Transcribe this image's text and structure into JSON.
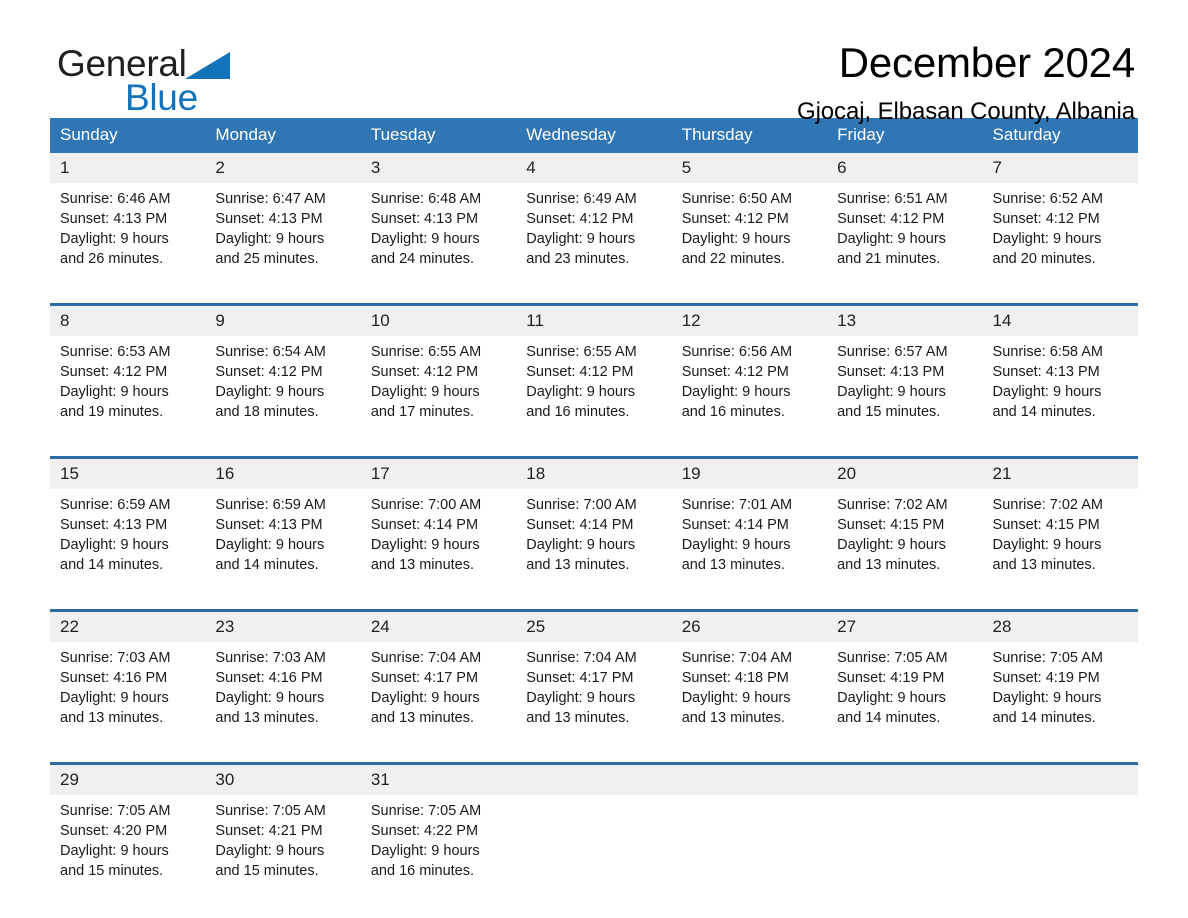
{
  "logo": {
    "word1": "General",
    "word2": "Blue",
    "triangle_color": "#1273ba"
  },
  "header": {
    "title": "December 2024",
    "subtitle": "Gjocaj, Elbasan County, Albania"
  },
  "theme": {
    "header_blue": "#3076b5",
    "separator_blue": "#2e6da4",
    "daynum_bg": "#f0f0f0"
  },
  "calendar": {
    "weekday_headers": [
      "Sunday",
      "Monday",
      "Tuesday",
      "Wednesday",
      "Thursday",
      "Friday",
      "Saturday"
    ],
    "weeks": [
      [
        {
          "day": "1",
          "sunrise": "Sunrise: 6:46 AM",
          "sunset": "Sunset: 4:13 PM",
          "daylight1": "Daylight: 9 hours",
          "daylight2": "and 26 minutes."
        },
        {
          "day": "2",
          "sunrise": "Sunrise: 6:47 AM",
          "sunset": "Sunset: 4:13 PM",
          "daylight1": "Daylight: 9 hours",
          "daylight2": "and 25 minutes."
        },
        {
          "day": "3",
          "sunrise": "Sunrise: 6:48 AM",
          "sunset": "Sunset: 4:13 PM",
          "daylight1": "Daylight: 9 hours",
          "daylight2": "and 24 minutes."
        },
        {
          "day": "4",
          "sunrise": "Sunrise: 6:49 AM",
          "sunset": "Sunset: 4:12 PM",
          "daylight1": "Daylight: 9 hours",
          "daylight2": "and 23 minutes."
        },
        {
          "day": "5",
          "sunrise": "Sunrise: 6:50 AM",
          "sunset": "Sunset: 4:12 PM",
          "daylight1": "Daylight: 9 hours",
          "daylight2": "and 22 minutes."
        },
        {
          "day": "6",
          "sunrise": "Sunrise: 6:51 AM",
          "sunset": "Sunset: 4:12 PM",
          "daylight1": "Daylight: 9 hours",
          "daylight2": "and 21 minutes."
        },
        {
          "day": "7",
          "sunrise": "Sunrise: 6:52 AM",
          "sunset": "Sunset: 4:12 PM",
          "daylight1": "Daylight: 9 hours",
          "daylight2": "and 20 minutes."
        }
      ],
      [
        {
          "day": "8",
          "sunrise": "Sunrise: 6:53 AM",
          "sunset": "Sunset: 4:12 PM",
          "daylight1": "Daylight: 9 hours",
          "daylight2": "and 19 minutes."
        },
        {
          "day": "9",
          "sunrise": "Sunrise: 6:54 AM",
          "sunset": "Sunset: 4:12 PM",
          "daylight1": "Daylight: 9 hours",
          "daylight2": "and 18 minutes."
        },
        {
          "day": "10",
          "sunrise": "Sunrise: 6:55 AM",
          "sunset": "Sunset: 4:12 PM",
          "daylight1": "Daylight: 9 hours",
          "daylight2": "and 17 minutes."
        },
        {
          "day": "11",
          "sunrise": "Sunrise: 6:55 AM",
          "sunset": "Sunset: 4:12 PM",
          "daylight1": "Daylight: 9 hours",
          "daylight2": "and 16 minutes."
        },
        {
          "day": "12",
          "sunrise": "Sunrise: 6:56 AM",
          "sunset": "Sunset: 4:12 PM",
          "daylight1": "Daylight: 9 hours",
          "daylight2": "and 16 minutes."
        },
        {
          "day": "13",
          "sunrise": "Sunrise: 6:57 AM",
          "sunset": "Sunset: 4:13 PM",
          "daylight1": "Daylight: 9 hours",
          "daylight2": "and 15 minutes."
        },
        {
          "day": "14",
          "sunrise": "Sunrise: 6:58 AM",
          "sunset": "Sunset: 4:13 PM",
          "daylight1": "Daylight: 9 hours",
          "daylight2": "and 14 minutes."
        }
      ],
      [
        {
          "day": "15",
          "sunrise": "Sunrise: 6:59 AM",
          "sunset": "Sunset: 4:13 PM",
          "daylight1": "Daylight: 9 hours",
          "daylight2": "and 14 minutes."
        },
        {
          "day": "16",
          "sunrise": "Sunrise: 6:59 AM",
          "sunset": "Sunset: 4:13 PM",
          "daylight1": "Daylight: 9 hours",
          "daylight2": "and 14 minutes."
        },
        {
          "day": "17",
          "sunrise": "Sunrise: 7:00 AM",
          "sunset": "Sunset: 4:14 PM",
          "daylight1": "Daylight: 9 hours",
          "daylight2": "and 13 minutes."
        },
        {
          "day": "18",
          "sunrise": "Sunrise: 7:00 AM",
          "sunset": "Sunset: 4:14 PM",
          "daylight1": "Daylight: 9 hours",
          "daylight2": "and 13 minutes."
        },
        {
          "day": "19",
          "sunrise": "Sunrise: 7:01 AM",
          "sunset": "Sunset: 4:14 PM",
          "daylight1": "Daylight: 9 hours",
          "daylight2": "and 13 minutes."
        },
        {
          "day": "20",
          "sunrise": "Sunrise: 7:02 AM",
          "sunset": "Sunset: 4:15 PM",
          "daylight1": "Daylight: 9 hours",
          "daylight2": "and 13 minutes."
        },
        {
          "day": "21",
          "sunrise": "Sunrise: 7:02 AM",
          "sunset": "Sunset: 4:15 PM",
          "daylight1": "Daylight: 9 hours",
          "daylight2": "and 13 minutes."
        }
      ],
      [
        {
          "day": "22",
          "sunrise": "Sunrise: 7:03 AM",
          "sunset": "Sunset: 4:16 PM",
          "daylight1": "Daylight: 9 hours",
          "daylight2": "and 13 minutes."
        },
        {
          "day": "23",
          "sunrise": "Sunrise: 7:03 AM",
          "sunset": "Sunset: 4:16 PM",
          "daylight1": "Daylight: 9 hours",
          "daylight2": "and 13 minutes."
        },
        {
          "day": "24",
          "sunrise": "Sunrise: 7:04 AM",
          "sunset": "Sunset: 4:17 PM",
          "daylight1": "Daylight: 9 hours",
          "daylight2": "and 13 minutes."
        },
        {
          "day": "25",
          "sunrise": "Sunrise: 7:04 AM",
          "sunset": "Sunset: 4:17 PM",
          "daylight1": "Daylight: 9 hours",
          "daylight2": "and 13 minutes."
        },
        {
          "day": "26",
          "sunrise": "Sunrise: 7:04 AM",
          "sunset": "Sunset: 4:18 PM",
          "daylight1": "Daylight: 9 hours",
          "daylight2": "and 13 minutes."
        },
        {
          "day": "27",
          "sunrise": "Sunrise: 7:05 AM",
          "sunset": "Sunset: 4:19 PM",
          "daylight1": "Daylight: 9 hours",
          "daylight2": "and 14 minutes."
        },
        {
          "day": "28",
          "sunrise": "Sunrise: 7:05 AM",
          "sunset": "Sunset: 4:19 PM",
          "daylight1": "Daylight: 9 hours",
          "daylight2": "and 14 minutes."
        }
      ],
      [
        {
          "day": "29",
          "sunrise": "Sunrise: 7:05 AM",
          "sunset": "Sunset: 4:20 PM",
          "daylight1": "Daylight: 9 hours",
          "daylight2": "and 15 minutes."
        },
        {
          "day": "30",
          "sunrise": "Sunrise: 7:05 AM",
          "sunset": "Sunset: 4:21 PM",
          "daylight1": "Daylight: 9 hours",
          "daylight2": "and 15 minutes."
        },
        {
          "day": "31",
          "sunrise": "Sunrise: 7:05 AM",
          "sunset": "Sunset: 4:22 PM",
          "daylight1": "Daylight: 9 hours",
          "daylight2": "and 16 minutes."
        },
        {
          "day": "",
          "sunrise": "",
          "sunset": "",
          "daylight1": "",
          "daylight2": ""
        },
        {
          "day": "",
          "sunrise": "",
          "sunset": "",
          "daylight1": "",
          "daylight2": ""
        },
        {
          "day": "",
          "sunrise": "",
          "sunset": "",
          "daylight1": "",
          "daylight2": ""
        },
        {
          "day": "",
          "sunrise": "",
          "sunset": "",
          "daylight1": "",
          "daylight2": ""
        }
      ]
    ]
  }
}
